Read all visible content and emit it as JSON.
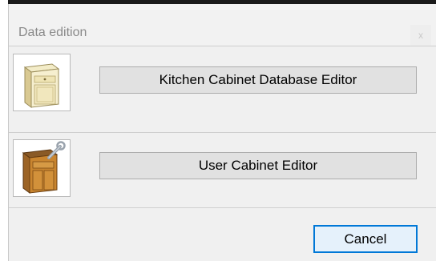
{
  "window": {
    "title": "Data edition",
    "close_glyph": "x"
  },
  "options": [
    {
      "label": "Kitchen Cabinet Database Editor",
      "icon": "base-cabinet-icon"
    },
    {
      "label": "User Cabinet Editor",
      "icon": "user-cabinet-icon"
    }
  ],
  "footer": {
    "cancel_label": "Cancel"
  },
  "colors": {
    "accent": "#0078d7",
    "button_face": "#e1e1e1",
    "dialog_bg": "#f0f0f0"
  }
}
